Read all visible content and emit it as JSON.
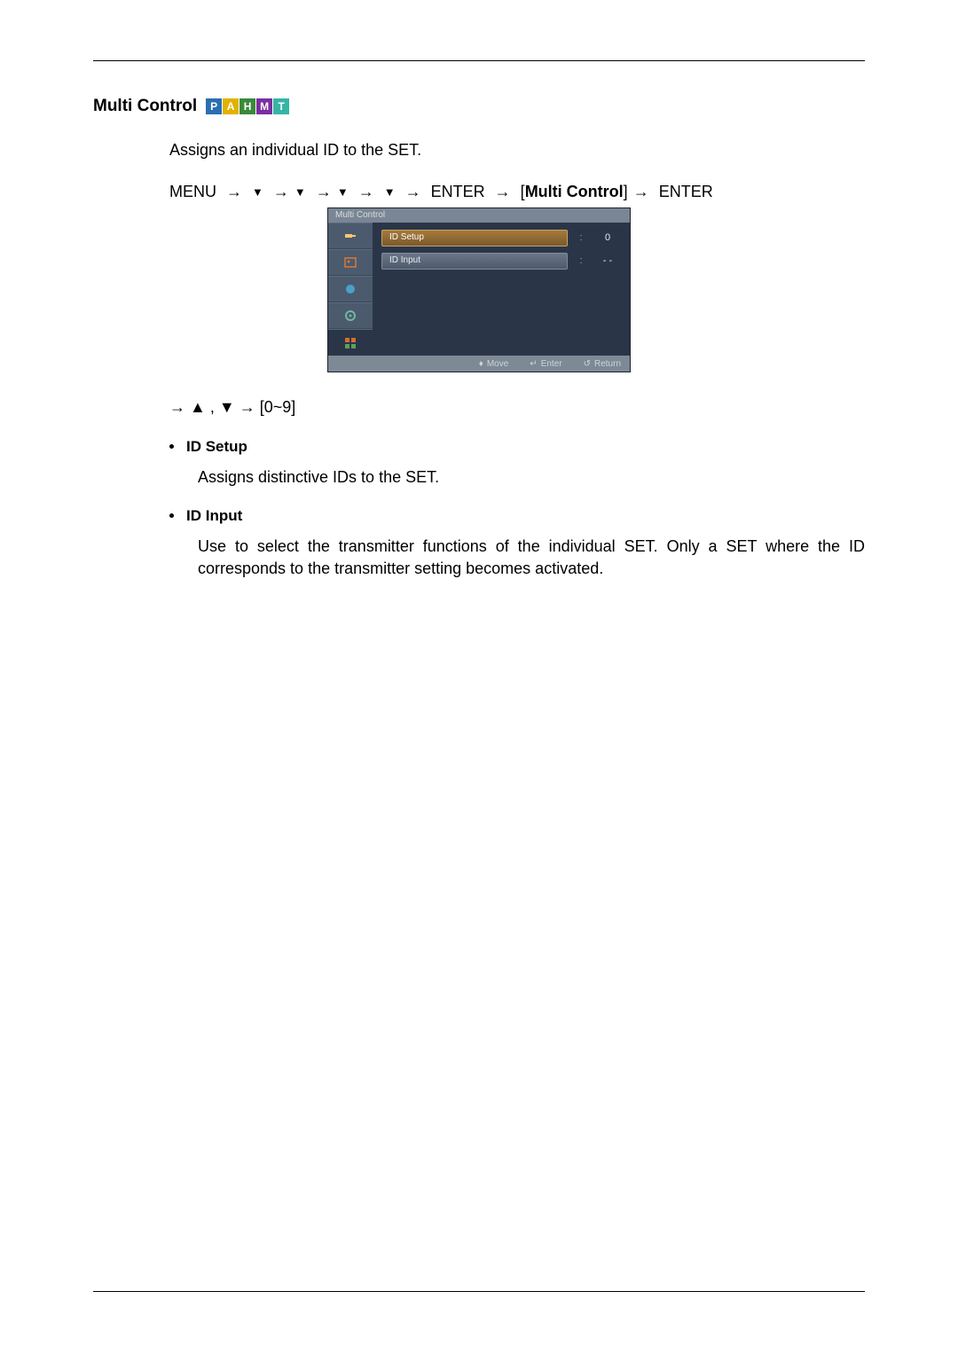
{
  "section": {
    "title": "Multi Control",
    "modes": [
      {
        "label": "P",
        "bg": "#2a6fb3"
      },
      {
        "label": "A",
        "bg": "#e2b100"
      },
      {
        "label": "H",
        "bg": "#3a8a3a"
      },
      {
        "label": "M",
        "bg": "#7a2fa0"
      },
      {
        "label": "T",
        "bg": "#36b5a6"
      }
    ]
  },
  "intro": "Assigns an individual ID to the SET.",
  "path": {
    "menu": "MENU",
    "enter": "ENTER",
    "bracket_label": "Multi Control"
  },
  "osd": {
    "title": "Multi Control",
    "rows": [
      {
        "label": "ID Setup",
        "value": "0",
        "selected": true
      },
      {
        "label": "ID Input",
        "value": "- -",
        "selected": false
      }
    ],
    "footer": {
      "move": "Move",
      "enter": "Enter",
      "return": "Return"
    }
  },
  "post_nav": {
    "range": "[0~9]"
  },
  "bullets": [
    {
      "title": "ID Setup",
      "body": "Assigns distinctive IDs to the SET."
    },
    {
      "title": "ID Input",
      "body": "Use to select the transmitter functions of the individual SET. Only a SET where the ID corresponds to the transmitter setting becomes activated."
    }
  ]
}
